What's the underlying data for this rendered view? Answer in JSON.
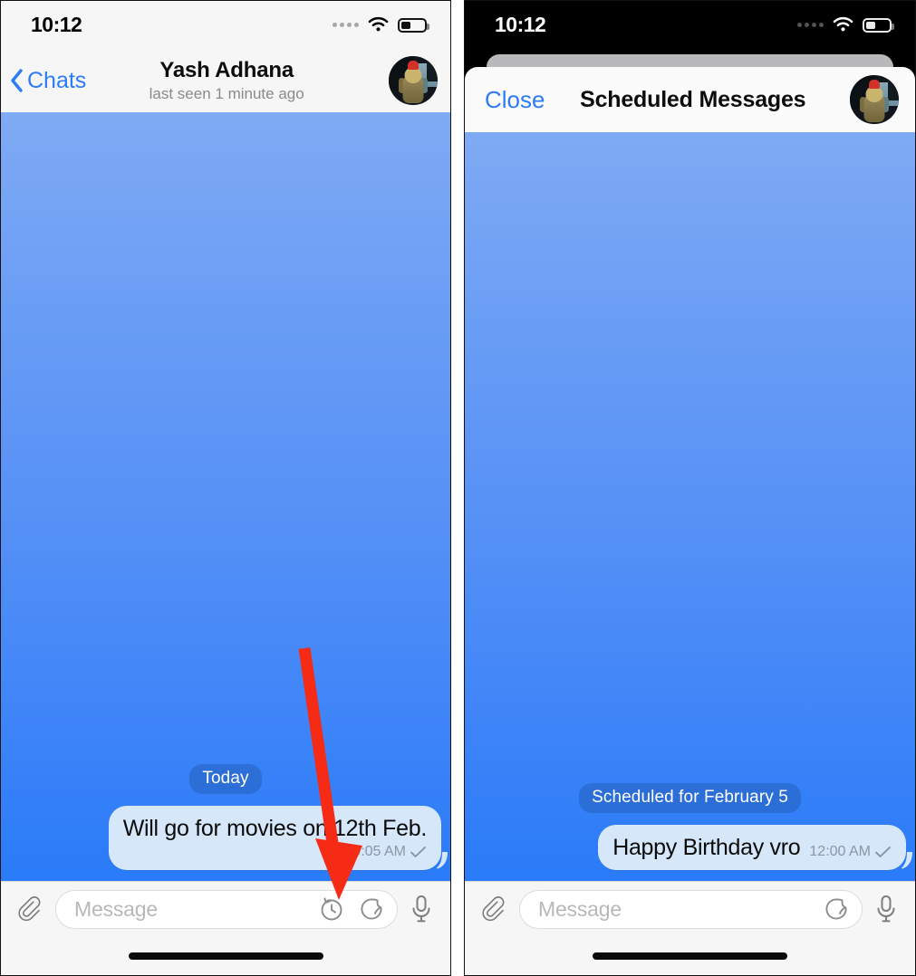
{
  "accent_color": "#2b7cf6",
  "bubble_color": "#d5e7f8",
  "annotation_color": "#f62b16",
  "chat_bg_top": "#7faaf4",
  "chat_bg_bottom": "#2a7bf8",
  "screens": [
    {
      "id": "chat-screen",
      "status_bar": {
        "time": "10:12",
        "signal_icon": "signal-dots-icon",
        "wifi_icon": "wifi-icon",
        "battery_icon": "battery-icon",
        "battery_level": "40"
      },
      "nav_bar": {
        "back_label": "Chats",
        "back_icon": "chevron-left-icon",
        "title": "Yash Adhana",
        "subtitle": "last seen 1 minute ago",
        "avatar_icon": "contact-avatar"
      },
      "conversation": {
        "day_badge": "Today",
        "messages": [
          {
            "text": "Will go for movies on 12th Feb.",
            "time": "10:05 AM",
            "status_icon": "single-check-icon",
            "outgoing": true
          }
        ]
      },
      "input_bar": {
        "attach_icon": "paperclip-icon",
        "placeholder": "Message",
        "value": "",
        "schedule_icon": "clock-arrow-icon",
        "sticker_icon": "sticker-icon",
        "mic_icon": "microphone-icon",
        "has_schedule_icon": true
      }
    },
    {
      "id": "scheduled-messages-screen",
      "status_bar": {
        "time": "10:12",
        "signal_icon": "signal-dots-icon",
        "wifi_icon": "wifi-icon",
        "battery_icon": "battery-icon",
        "battery_level": "40"
      },
      "sheet_header": {
        "close_label": "Close",
        "title": "Scheduled Messages",
        "avatar_icon": "contact-avatar"
      },
      "conversation": {
        "day_badge": "Scheduled for February 5",
        "messages": [
          {
            "text": "Happy Birthday vro",
            "time": "12:00 AM",
            "status_icon": "single-check-icon",
            "outgoing": true
          }
        ]
      },
      "input_bar": {
        "attach_icon": "paperclip-icon",
        "placeholder": "Message",
        "value": "",
        "sticker_icon": "sticker-icon",
        "mic_icon": "microphone-icon",
        "has_schedule_icon": false
      }
    }
  ],
  "annotation": {
    "type": "arrow",
    "points_to": "schedule-message-icon",
    "color": "#f62b16"
  }
}
